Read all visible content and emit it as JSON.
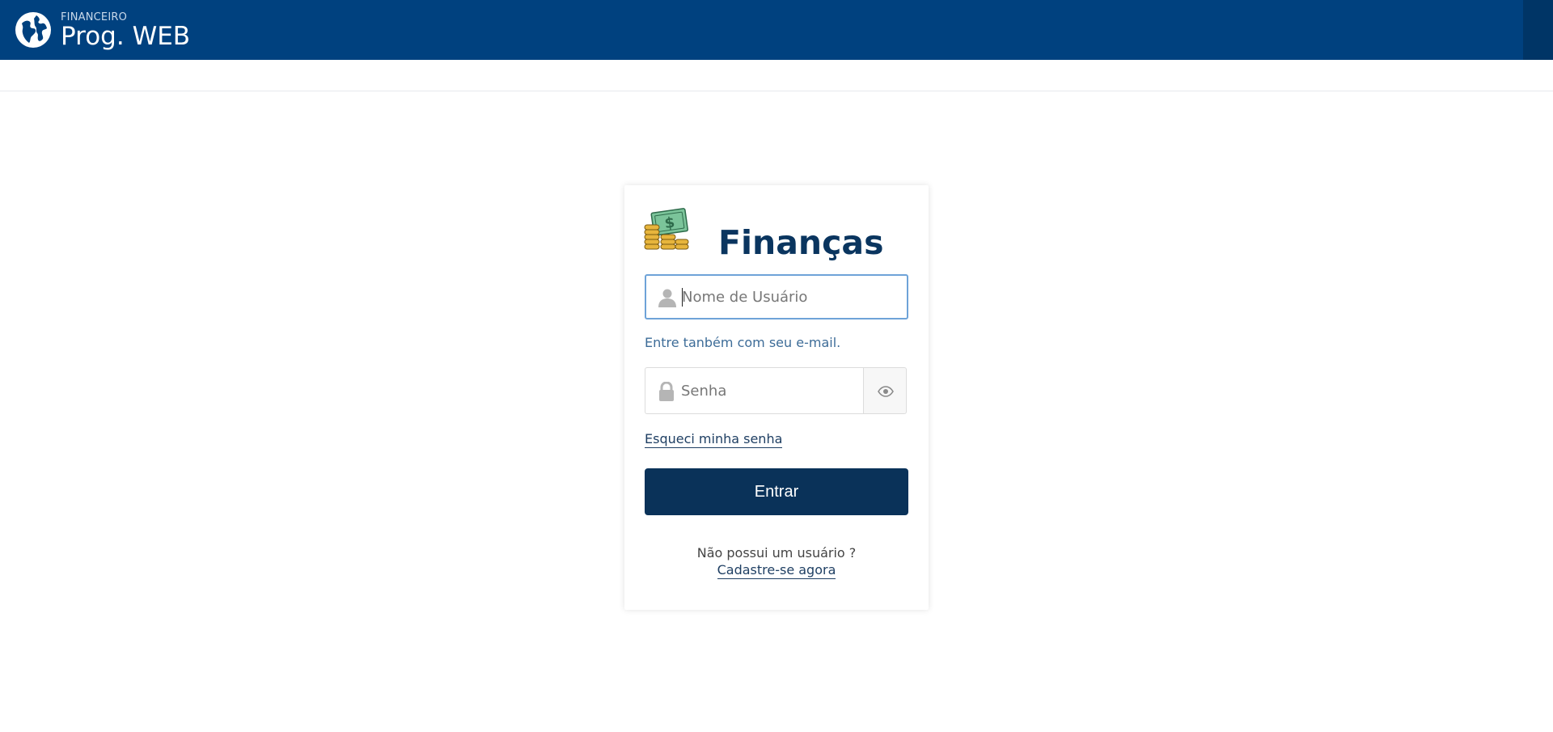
{
  "header": {
    "app_small": "FINANCEIRO",
    "app_title": "Prog. WEB",
    "logo_icon": "globe-icon",
    "bar_color": "#00417f"
  },
  "login": {
    "logo_icon": "money-icon",
    "title": "Finanças",
    "username": {
      "placeholder": "Nome de Usuário",
      "value": "",
      "icon": "user-icon"
    },
    "hint": "Entre tanbém com seu e-mail.",
    "password": {
      "placeholder": "Senha",
      "value": "",
      "icon": "lock-icon",
      "toggle_icon": "eye-icon"
    },
    "forgot_label": "Esqueci minha senha",
    "submit_label": "Entrar",
    "no_account_text": "Não possui um usuário ?",
    "signup_label": "Cadastre-se agora",
    "accent_color": "#0a3259"
  }
}
